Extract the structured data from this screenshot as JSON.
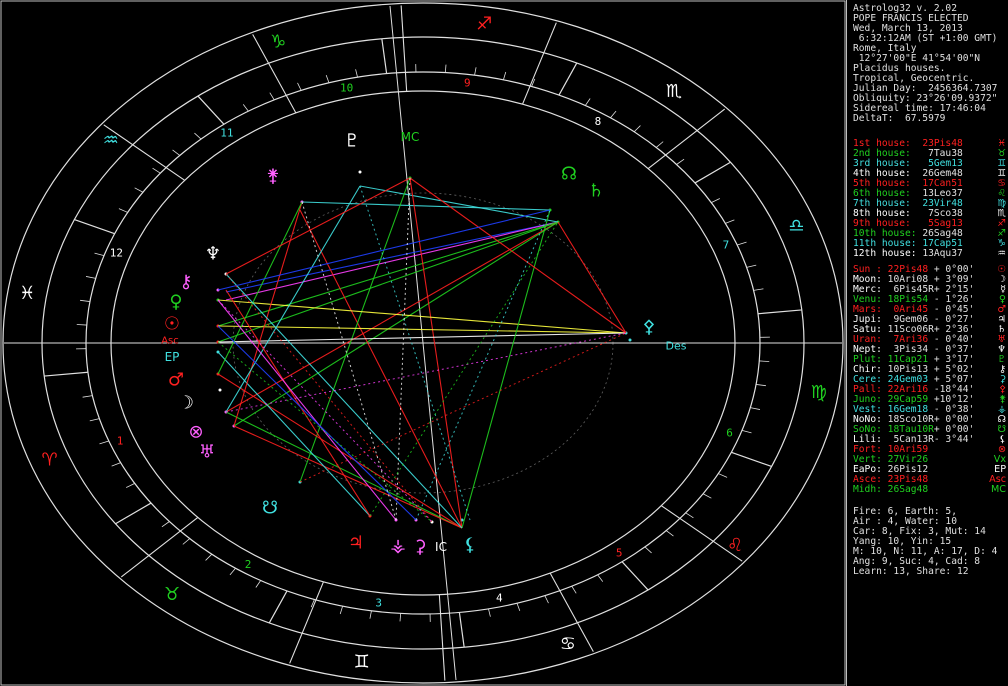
{
  "header": {
    "app": "Astrolog32 v. 2.02",
    "title": "POPE FRANCIS ELECTED",
    "date": "Wed, March 13, 2013",
    "time": " 6:32:12AM (ST +1:00 GMT)",
    "place": "Rome, Italy",
    "coords": " 12°27'00\"E 41°54'00\"N",
    "houses": "Placidus houses.",
    "zodiac": "Tropical, Geocentric.",
    "julian": "Julian Day:  2456364.7307",
    "obliquity": "Obliquity: 23°26'09.9372\"",
    "sidereal": "Sidereal time: 17:46:04",
    "deltat": "DeltaT:  67.5979"
  },
  "house_cusps": [
    {
      "label": "1st house:",
      "pos": "23Pis48",
      "color": "#ff2020",
      "glyph": "♓"
    },
    {
      "label": "2nd house:",
      "pos": " 7Tau38",
      "color": "#20d020",
      "glyph": "♉"
    },
    {
      "label": "3rd house:",
      "pos": " 5Gem13",
      "color": "#40e0e0",
      "glyph": "♊"
    },
    {
      "label": "4th house:",
      "pos": "26Gem48",
      "color": "#ffffff",
      "glyph": "♊"
    },
    {
      "label": "5th house:",
      "pos": "17Can51",
      "color": "#ff2020",
      "glyph": "♋"
    },
    {
      "label": "6th house:",
      "pos": "13Leo37",
      "color": "#20d020",
      "glyph": "♌"
    },
    {
      "label": "7th house:",
      "pos": "23Vir48",
      "color": "#40e0e0",
      "glyph": "♍"
    },
    {
      "label": "8th house:",
      "pos": " 7Sco38",
      "color": "#ffffff",
      "glyph": "♏"
    },
    {
      "label": "9th house:",
      "pos": " 5Sag13",
      "color": "#ff2020",
      "glyph": "♐"
    },
    {
      "label": "10th house:",
      "pos": "26Sag48",
      "color": "#20d020",
      "glyph": "♐"
    },
    {
      "label": "11th house:",
      "pos": "17Cap51",
      "color": "#40e0e0",
      "glyph": "♑"
    },
    {
      "label": "12th house:",
      "pos": "13Aqu37",
      "color": "#ffffff",
      "glyph": "♒"
    }
  ],
  "planets": [
    {
      "name": "Sun :",
      "pos": "22Pis48",
      "aspect": " + 0°00'",
      "color": "#ff2020",
      "glyph": "☉"
    },
    {
      "name": "Moon:",
      "pos": "10Ari08",
      "aspect": " + 3°09'",
      "color": "#ffffff",
      "glyph": "☽"
    },
    {
      "name": "Merc:",
      "pos": " 6Pis45R",
      "aspect": "+ 2°15'",
      "color": "#ffffff",
      "glyph": "☿"
    },
    {
      "name": "Venu:",
      "pos": "18Pis54",
      "aspect": " - 1°26'",
      "color": "#20d020",
      "glyph": "♀"
    },
    {
      "name": "Mars:",
      "pos": " 0Ari45",
      "aspect": " - 0°45'",
      "color": "#ff2020",
      "glyph": "♂"
    },
    {
      "name": "Jupi:",
      "pos": " 9Gem06",
      "aspect": " - 0°27'",
      "color": "#ffffff",
      "glyph": "♃"
    },
    {
      "name": "Satu:",
      "pos": "11Sco06R",
      "aspect": "+ 2°36'",
      "color": "#ffffff",
      "glyph": "♄"
    },
    {
      "name": "Uran:",
      "pos": " 7Ari36",
      "aspect": " - 0°40'",
      "color": "#ff2020",
      "glyph": "♅"
    },
    {
      "name": "Nept:",
      "pos": " 3Pis34",
      "aspect": " - 0°37'",
      "color": "#ffffff",
      "glyph": "♆"
    },
    {
      "name": "Plut:",
      "pos": "11Cap21",
      "aspect": " + 3°17'",
      "color": "#20d020",
      "glyph": "♇"
    },
    {
      "name": "Chir:",
      "pos": "10Pis13",
      "aspect": " + 5°02'",
      "color": "#ffffff",
      "glyph": "⚷"
    },
    {
      "name": "Cere:",
      "pos": "24Gem03",
      "aspect": " + 5°07'",
      "color": "#40e0e0",
      "glyph": "⚳"
    },
    {
      "name": "Pall:",
      "pos": "22Ari16",
      "aspect": " -18°44'",
      "color": "#ff2020",
      "glyph": "⚴"
    },
    {
      "name": "Juno:",
      "pos": "29Cap59",
      "aspect": " +10°12'",
      "color": "#20d020",
      "glyph": "⚵"
    },
    {
      "name": "Vest:",
      "pos": "16Gem18",
      "aspect": " - 0°38'",
      "color": "#40e0e0",
      "glyph": "⚶"
    },
    {
      "name": "NoNo:",
      "pos": "18Sco10R",
      "aspect": "+ 0°00'",
      "color": "#ffffff",
      "glyph": "☊"
    },
    {
      "name": "SoNo:",
      "pos": "18Tau10R",
      "aspect": "+ 0°00'",
      "color": "#20d020",
      "glyph": "☋"
    },
    {
      "name": "Lili:",
      "pos": " 5Can13R",
      "aspect": "- 3°44'",
      "color": "#ffffff",
      "glyph": "⚸"
    },
    {
      "name": "Fort:",
      "pos": "10Ari59",
      "aspect": "",
      "color": "#ff2020",
      "glyph": "⊗"
    },
    {
      "name": "Vert:",
      "pos": "27Vir26",
      "aspect": "",
      "color": "#20d020",
      "glyph": "Vx"
    },
    {
      "name": "EaPo:",
      "pos": "26Pis12",
      "aspect": "",
      "color": "#ffffff",
      "glyph": "EP"
    },
    {
      "name": "Asce:",
      "pos": "23Pis48",
      "aspect": "",
      "color": "#ff2020",
      "glyph": "Asc"
    },
    {
      "name": "Midh:",
      "pos": "26Sag48",
      "aspect": "",
      "color": "#20d020",
      "glyph": "MC"
    }
  ],
  "summary": [
    "Fire: 6, Earth: 5,",
    "Air : 4, Water: 10",
    "Car: 8, Fix: 3, Mut: 14",
    "Yang: 10, Yin: 15",
    "M: 10, N: 11, A: 17, D: 4",
    "Ang: 9, Suc: 4, Cad: 8",
    "Learn: 13, Share: 12"
  ],
  "wheel": {
    "sign_glyphs": [
      "♈",
      "♉",
      "♊",
      "♋",
      "♌",
      "♍",
      "♎",
      "♏",
      "♐",
      "♑",
      "♒",
      "♓"
    ],
    "sign_colors": [
      "#ff2020",
      "#20d020",
      "#ffffff",
      "#ffffff",
      "#ff2020",
      "#20d020",
      "#40e0e0",
      "#ffffff",
      "#ff2020",
      "#20d020",
      "#40e0e0",
      "#ffffff"
    ],
    "house_numbers": [
      "1",
      "2",
      "3",
      "4",
      "5",
      "6",
      "7",
      "8",
      "9",
      "10",
      "11",
      "12"
    ],
    "house_number_colors": [
      "#ff2020",
      "#20d020",
      "#40e0e0",
      "#ffffff",
      "#ff2020",
      "#20d020",
      "#40e0e0",
      "#ffffff",
      "#ff2020",
      "#20d020",
      "#40e0e0",
      "#ffffff"
    ],
    "angle_labels": {
      "asc": "Asc",
      "des": "Des",
      "mc": "MC",
      "ic": "IC",
      "ep": "EP"
    }
  }
}
